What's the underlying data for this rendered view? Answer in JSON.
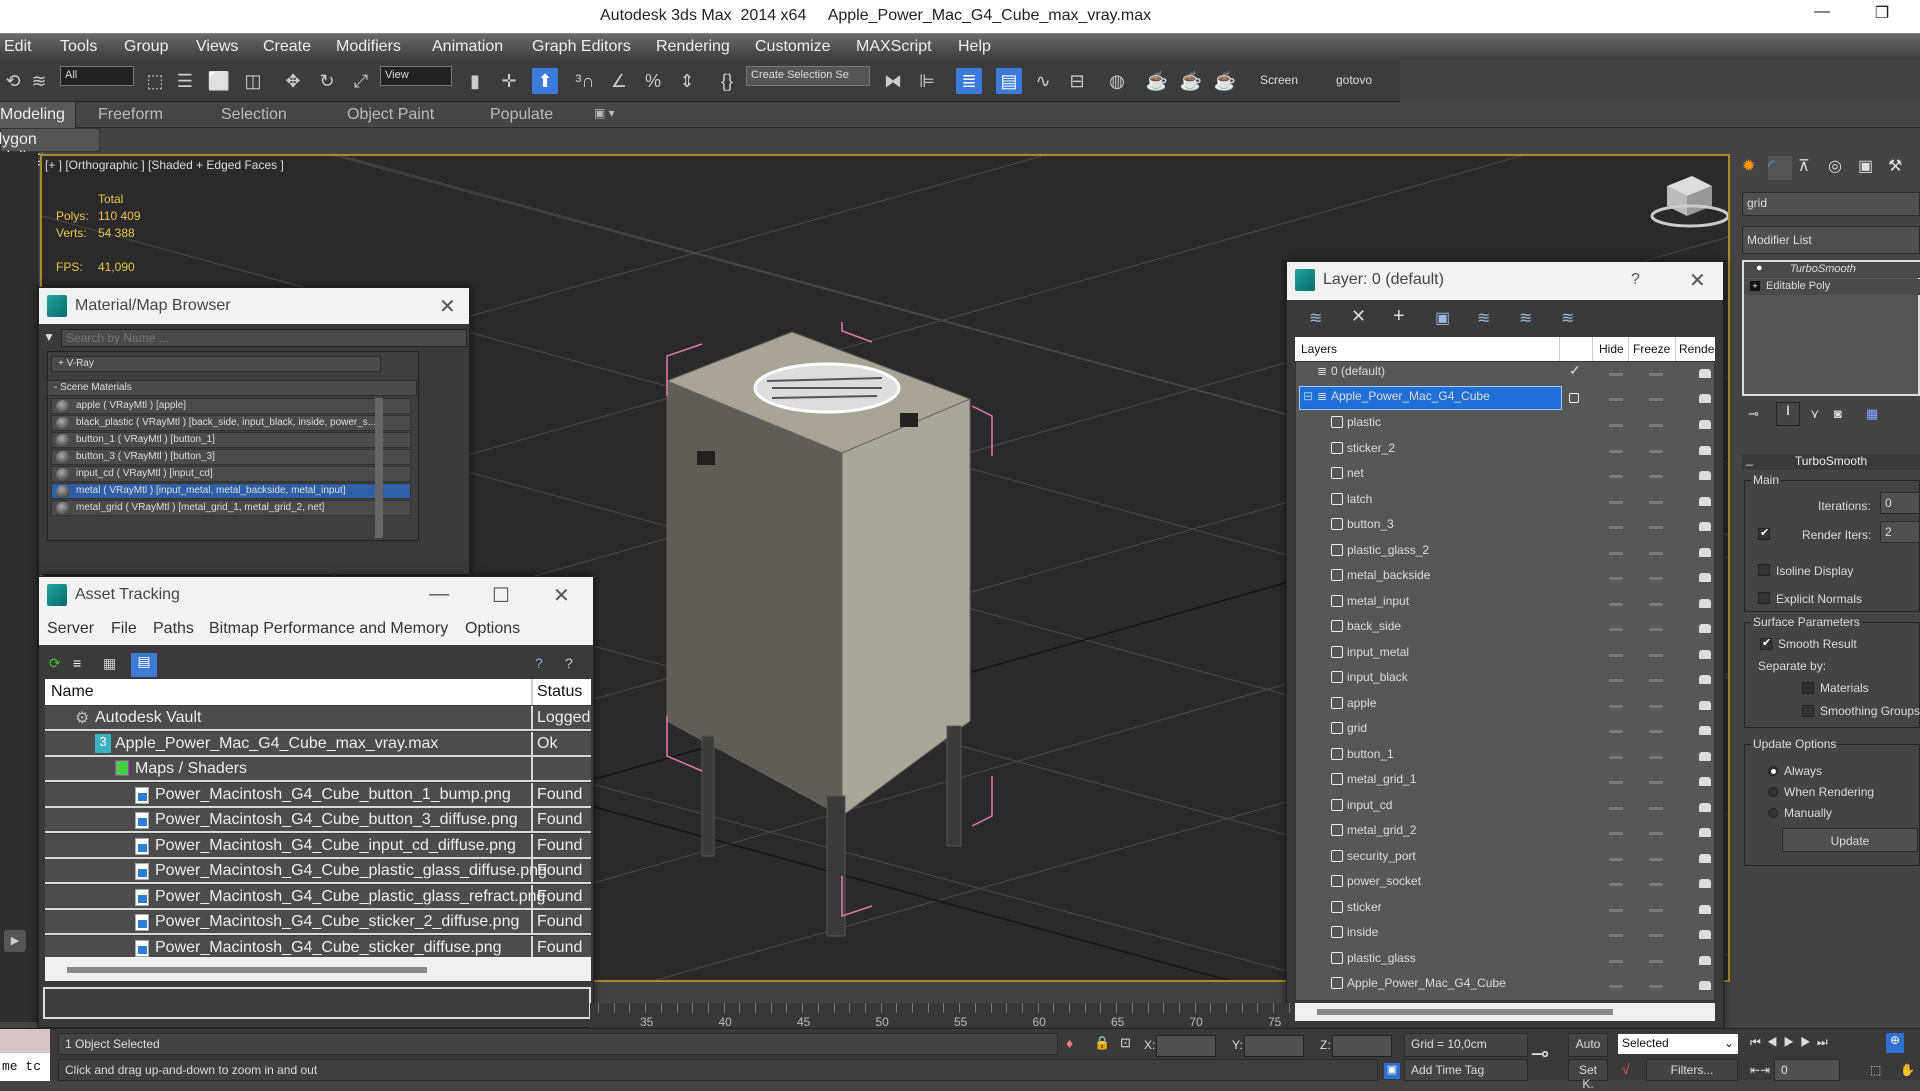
{
  "window": {
    "title": "Autodesk 3ds Max  2014 x64     Apple_Power_Mac_G4_Cube_max_vray.max",
    "minimize": "—",
    "restore": "❐"
  },
  "menubar": [
    "Edit",
    "Tools",
    "Group",
    "Views",
    "Create",
    "Modifiers",
    "Animation",
    "Graph Editors",
    "Rendering",
    "Customize",
    "MAXScript",
    "Help"
  ],
  "toolbar": {
    "selection_filter": "All",
    "reference_coord": "View",
    "named_selection": "Create Selection Se",
    "label_screen": "Screen",
    "label_gotovo": "gotovo"
  },
  "ribbon": {
    "tabs": [
      "Modeling",
      "Freeform",
      "Selection",
      "Object Paint",
      "Populate"
    ],
    "active_tab": "Modeling",
    "sub_tab": "Polygon Modeling"
  },
  "viewport": {
    "label": "[+ ] [Orthographic ] [Shaded + Edged Faces ]",
    "stats": {
      "total_label": "Total",
      "polys_label": "Polys:",
      "polys": "110 409",
      "verts_label": "Verts:",
      "verts": "54 388",
      "fps_label": "FPS:",
      "fps": "41,090"
    }
  },
  "material_browser": {
    "title": "Material/Map Browser",
    "search_placeholder": "Search by Name ...",
    "vray_group": "+ V-Ray",
    "scene_group": "- Scene Materials",
    "materials": [
      {
        "label": "apple  ( VRayMtl )  [apple]",
        "selected": false
      },
      {
        "label": "black_plastic  ( VRayMtl )  [back_side, input_black, inside, power_s...",
        "selected": false
      },
      {
        "label": "button_1  ( VRayMtl )  [button_1]",
        "selected": false
      },
      {
        "label": "button_3  ( VRayMtl )  [button_3]",
        "selected": false
      },
      {
        "label": "input_cd  ( VRayMtl )  [input_cd]",
        "selected": false
      },
      {
        "label": "metal  ( VRayMtl )  [input_metal, metal_backside, metal_input]",
        "selected": true
      },
      {
        "label": "metal_grid  ( VRayMtl )  [metal_grid_1, metal_grid_2, net]",
        "selected": false
      }
    ]
  },
  "asset_tracking": {
    "title": "Asset Tracking",
    "menus": [
      "Server",
      "File",
      "Paths",
      "Bitmap Performance and Memory",
      "Options"
    ],
    "columns": {
      "name": "Name",
      "status": "Status"
    },
    "rows": [
      {
        "name": "Autodesk Vault",
        "status": "Logged",
        "level": 1,
        "icon": "vault-icon"
      },
      {
        "name": "Apple_Power_Mac_G4_Cube_max_vray.max",
        "status": "Ok",
        "level": 2,
        "icon": "max-file-icon"
      },
      {
        "name": "Maps / Shaders",
        "status": "",
        "level": 3,
        "icon": "maps-icon"
      },
      {
        "name": "Power_Macintosh_G4_Cube_button_1_bump.png",
        "status": "Found",
        "level": 4,
        "icon": "image-file-icon"
      },
      {
        "name": "Power_Macintosh_G4_Cube_button_3_diffuse.png",
        "status": "Found",
        "level": 4,
        "icon": "image-file-icon"
      },
      {
        "name": "Power_Macintosh_G4_Cube_input_cd_diffuse.png",
        "status": "Found",
        "level": 4,
        "icon": "image-file-icon"
      },
      {
        "name": "Power_Macintosh_G4_Cube_plastic_glass_diffuse.png",
        "status": "Found",
        "level": 4,
        "icon": "image-file-icon"
      },
      {
        "name": "Power_Macintosh_G4_Cube_plastic_glass_refract.png",
        "status": "Found",
        "level": 4,
        "icon": "image-file-icon"
      },
      {
        "name": "Power_Macintosh_G4_Cube_sticker_2_diffuse.png",
        "status": "Found",
        "level": 4,
        "icon": "image-file-icon"
      },
      {
        "name": "Power_Macintosh_G4_Cube_sticker_diffuse.png",
        "status": "Found",
        "level": 4,
        "icon": "image-file-icon"
      }
    ]
  },
  "layer_dialog": {
    "title": "Layer: 0 (default)",
    "help": "?",
    "columns": {
      "layers": "Layers",
      "hide": "Hide",
      "freeze": "Freeze",
      "render": "Rende"
    },
    "default_layer": "0 (default)",
    "active_layer": "Apple_Power_Mac_G4_Cube",
    "objects": [
      "plastic",
      "sticker_2",
      "net",
      "latch",
      "button_3",
      "plastic_glass_2",
      "metal_backside",
      "metal_input",
      "back_side",
      "input_metal",
      "input_black",
      "apple",
      "grid",
      "button_1",
      "metal_grid_1",
      "input_cd",
      "metal_grid_2",
      "security_port",
      "power_socket",
      "sticker",
      "inside",
      "plastic_glass",
      "Apple_Power_Mac_G4_Cube"
    ]
  },
  "command_panel": {
    "object_name": "grid",
    "modifier_list": "Modifier List",
    "stack": [
      "TurboSmooth",
      "Editable Poly"
    ],
    "rollout_title": "TurboSmooth",
    "main_group": "Main",
    "iterations_label": "Iterations:",
    "iterations": "0",
    "render_iters_label": "Render Iters:",
    "render_iters": "2",
    "render_iters_checked": true,
    "isoline_display": "Isoline Display",
    "explicit_normals": "Explicit Normals",
    "surface_group": "Surface Parameters",
    "smooth_result": "Smooth Result",
    "separate_by": "Separate by:",
    "materials": "Materials",
    "smoothing_groups": "Smoothing Groups",
    "update_group": "Update Options",
    "update_always": "Always",
    "update_when_rendering": "When Rendering",
    "update_manually": "Manually",
    "update_button": "Update"
  },
  "timeline": {
    "ticks": [
      "35",
      "40",
      "45",
      "50",
      "55",
      "60",
      "65",
      "70",
      "75"
    ]
  },
  "status": {
    "left_script": "me  tc",
    "selection": "1 Object Selected",
    "prompt": "Click and drag up-and-down to zoom in and out",
    "x_label": "X:",
    "y_label": "Y:",
    "z_label": "Z:",
    "grid": "Grid = 10,0cm",
    "add_time_tag": "Add Time Tag",
    "auto": "Auto",
    "set_key": "Set K.",
    "key_filter": "Selected",
    "filters": "Filters...",
    "frame": "0"
  }
}
